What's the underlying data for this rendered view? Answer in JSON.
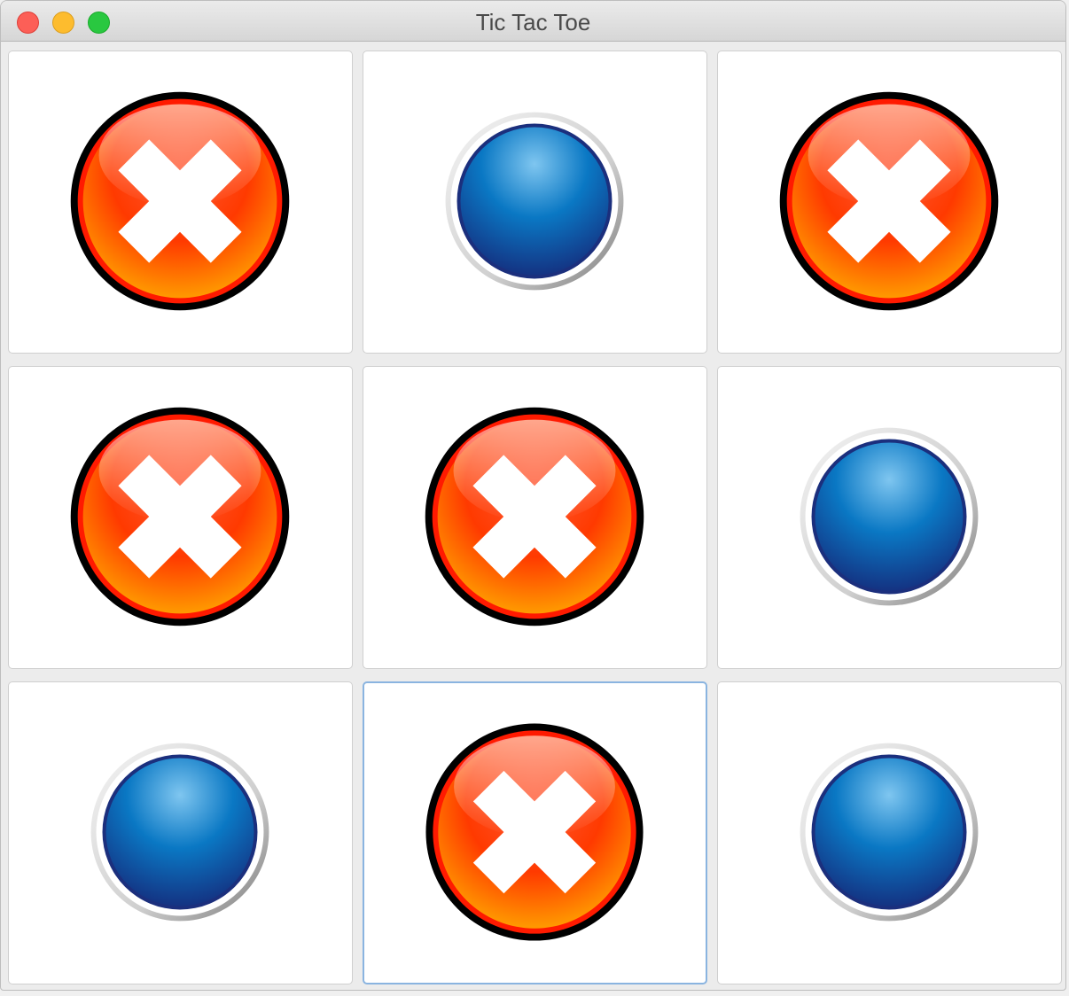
{
  "window": {
    "title": "Tic Tac Toe"
  },
  "colors": {
    "x_red": "#ff2a00",
    "x_orange": "#ff8a00",
    "o_blue": "#0a78c4",
    "o_dark_blue": "#152a7a",
    "focus_ring": "#8ab4e0"
  },
  "board": {
    "cells": [
      {
        "mark": "X",
        "icon": "x-mark-icon"
      },
      {
        "mark": "O",
        "icon": "o-mark-icon"
      },
      {
        "mark": "X",
        "icon": "x-mark-icon"
      },
      {
        "mark": "X",
        "icon": "x-mark-icon"
      },
      {
        "mark": "X",
        "icon": "x-mark-icon"
      },
      {
        "mark": "O",
        "icon": "o-mark-icon"
      },
      {
        "mark": "O",
        "icon": "o-mark-icon"
      },
      {
        "mark": "X",
        "icon": "x-mark-icon"
      },
      {
        "mark": "O",
        "icon": "o-mark-icon"
      }
    ],
    "focused_cell": 7
  }
}
